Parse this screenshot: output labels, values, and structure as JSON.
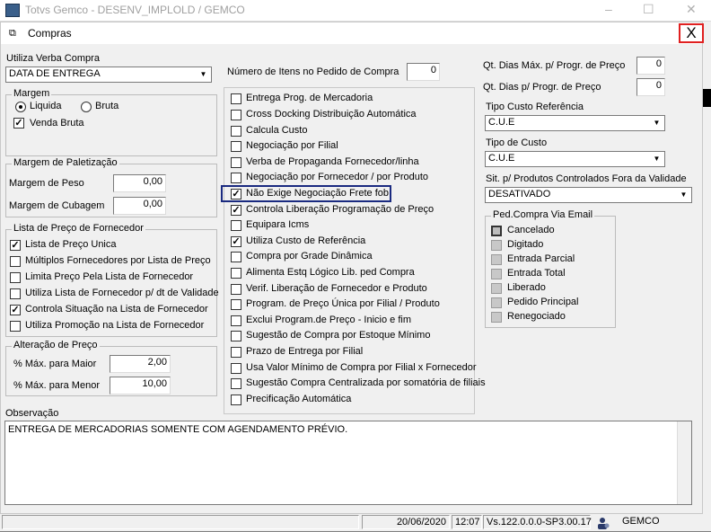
{
  "outer_window": {
    "title": "Totvs Gemco - DESENV_IMPLOLD / GEMCO"
  },
  "dialog": {
    "title": "Compras",
    "close_glyph": "X"
  },
  "left": {
    "utiliza_verba": {
      "label": "Utiliza Verba Compra",
      "value": "DATA DE ENTREGA"
    },
    "margem": {
      "title": "Margem",
      "liquida": "Liquida",
      "bruta": "Bruta",
      "venda_bruta": "Venda Bruta"
    },
    "paletizacao": {
      "title": "Margem de Paletização",
      "peso_label": "Margem de Peso",
      "peso_value": "0,00",
      "cubagem_label": "Margem de Cubagem",
      "cubagem_value": "0,00"
    },
    "lista_preco": {
      "title": "Lista de Preço de Fornecedor",
      "items": [
        {
          "label": "Lista de Preço Unica",
          "checked": true
        },
        {
          "label": "Múltiplos Fornecedores por Lista de Preço",
          "checked": false
        },
        {
          "label": "Limita Preço Pela Lista de Fornecedor",
          "checked": false
        },
        {
          "label": "Utiliza Lista de Fornecedor p/ dt de Validade",
          "checked": false
        },
        {
          "label": "Controla Situação na Lista de Fornecedor",
          "checked": true
        },
        {
          "label": "Utiliza Promoção na Lista de Fornecedor",
          "checked": false
        }
      ]
    },
    "alteracao": {
      "title": "Alteração de Preço",
      "maior_label": "% Máx. para Maior",
      "maior_value": "2,00",
      "menor_label": "% Máx. para Menor",
      "menor_value": "10,00"
    }
  },
  "middle": {
    "num_itens_label": "Número de Itens no Pedido de Compra",
    "num_itens_value": "0",
    "items": [
      {
        "label": "Entrega Prog. de Mercadoria",
        "checked": false
      },
      {
        "label": "Cross Docking Distribuição Automática",
        "checked": false
      },
      {
        "label": "Calcula Custo",
        "checked": false
      },
      {
        "label": "Negociação por Filial",
        "checked": false
      },
      {
        "label": "Verba de Propaganda Fornecedor/linha",
        "checked": false
      },
      {
        "label": "Negociação por Fornecedor / por Produto",
        "checked": false
      },
      {
        "label": "Não Exige Negociação Frete fob",
        "checked": true
      },
      {
        "label": "Controla Liberação Programação de Preço",
        "checked": true
      },
      {
        "label": "Equipara Icms",
        "checked": false
      },
      {
        "label": "Utiliza Custo de Referência",
        "checked": true
      },
      {
        "label": "Compra por Grade Dinâmica",
        "checked": false
      },
      {
        "label": "Alimenta Estq Lógico Lib. ped Compra",
        "checked": false
      },
      {
        "label": "Verif. Liberação de Fornecedor e Produto",
        "checked": false
      },
      {
        "label": "Program. de Preço Única por Filial / Produto",
        "checked": false
      },
      {
        "label": "Exclui Program.de Preço - Inicio e fim",
        "checked": false
      },
      {
        "label": "Sugestão de Compra por Estoque Mínimo",
        "checked": false
      },
      {
        "label": "Prazo de Entrega por Filial",
        "checked": false
      },
      {
        "label": "Usa Valor Mínimo de Compra por Filial x Fornecedor",
        "checked": false
      },
      {
        "label": "Sugestão Compra Centralizada por somatória de filiais",
        "checked": false
      },
      {
        "label": "Precificação Automática",
        "checked": false
      }
    ]
  },
  "right": {
    "dias_max_label": "Qt. Dias Máx. p/ Progr. de Preço",
    "dias_max_value": "0",
    "dias_label": "Qt. Dias p/ Progr. de Preço",
    "dias_value": "0",
    "tipo_custo_ref_label": "Tipo Custo Referência",
    "tipo_custo_ref_value": "C.U.E",
    "tipo_custo_label": "Tipo de Custo",
    "tipo_custo_value": "C.U.E",
    "sit_label": "Sit. p/ Produtos Controlados Fora da Validade",
    "sit_value": "DESATIVADO",
    "ped_compra": {
      "title": "Ped.Compra Via Email",
      "items": [
        "Cancelado",
        "Digitado",
        "Entrada Parcial",
        "Entrada Total",
        "Liberado",
        "Pedido Principal",
        "Renegociado"
      ]
    }
  },
  "observacao": {
    "label": "Observação",
    "text": "ENTREGA DE MERCADORIAS SOMENTE COM AGENDAMENTO PRÉVIO."
  },
  "statusbar": {
    "date": "20/06/2020",
    "time": "12:07",
    "version": "Vs.122.0.0.0-SP3.00.17",
    "env": "GEMCO"
  }
}
